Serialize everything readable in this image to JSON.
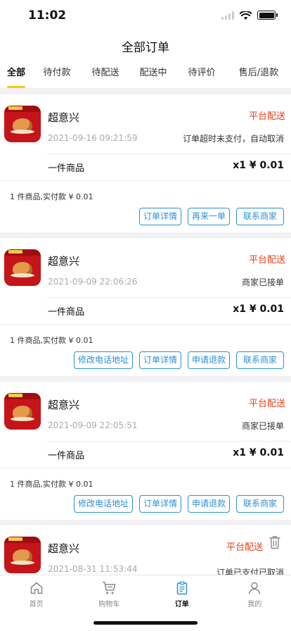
{
  "status_bar": {
    "time": "11:02"
  },
  "header": {
    "title": "全部订单"
  },
  "tabs": [
    {
      "label": "全部"
    },
    {
      "label": "待付款"
    },
    {
      "label": "待配送"
    },
    {
      "label": "配送中"
    },
    {
      "label": "待评价"
    },
    {
      "label": "售后/退款"
    }
  ],
  "orders": [
    {
      "shop": "超意兴",
      "delivery": "平台配送",
      "time": "2021-09-16 09:21:59",
      "status": "订单超时未支付，自动取消",
      "goods": "一件商品",
      "price": "x1 ¥ 0.01",
      "summary": "1 件商品,实付款 ¥ 0.01",
      "actions": [
        "订单详情",
        "再来一单",
        "联系商家"
      ]
    },
    {
      "shop": "超意兴",
      "delivery": "平台配送",
      "time": "2021-09-09 22:06:26",
      "status": "商家已接单",
      "goods": "一件商品",
      "price": "x1 ¥ 0.01",
      "summary": "1 件商品,实付款 ¥ 0.01",
      "actions": [
        "修改电话地址",
        "订单详情",
        "申请退款",
        "联系商家"
      ]
    },
    {
      "shop": "超意兴",
      "delivery": "平台配送",
      "time": "2021-09-09 22:05:51",
      "status": "商家已接单",
      "goods": "一件商品",
      "price": "x1 ¥ 0.01",
      "summary": "1 件商品,实付款 ¥ 0.01",
      "actions": [
        "修改电话地址",
        "订单详情",
        "申请退款",
        "联系商家"
      ]
    },
    {
      "shop": "超意兴",
      "delivery": "平台配送",
      "time": "2021-08-31 11:53:44",
      "status": "订单已支付已取消"
    }
  ],
  "tabbar": [
    {
      "label": "首页",
      "icon": "home-icon"
    },
    {
      "label": "购物车",
      "icon": "cart-icon"
    },
    {
      "label": "订单",
      "icon": "order-icon"
    },
    {
      "label": "我的",
      "icon": "profile-icon"
    }
  ],
  "colors": {
    "accent_red": "#e8401c",
    "button_blue": "#2d8fd6",
    "tab_underline": "#f5c518"
  }
}
